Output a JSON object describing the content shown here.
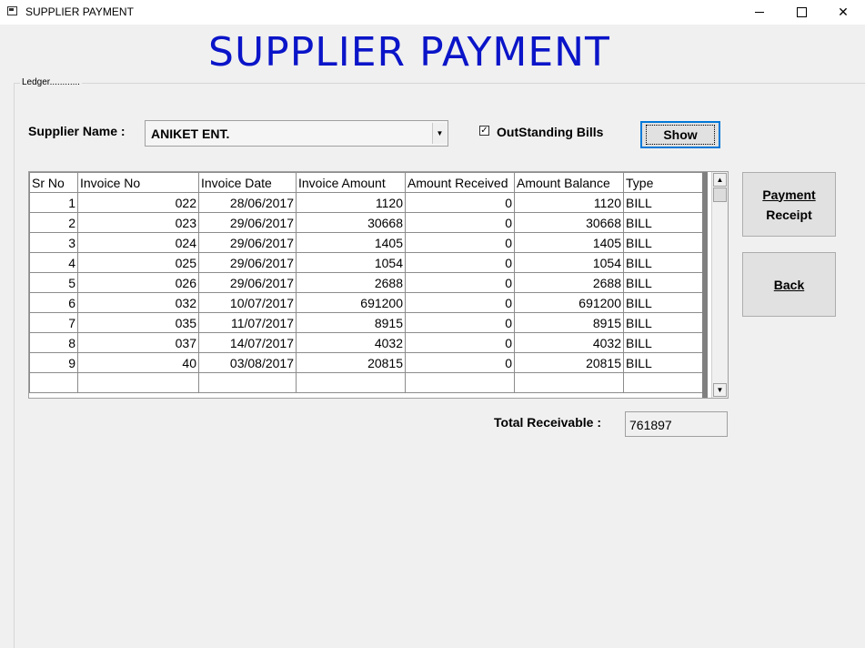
{
  "window": {
    "title": "SUPPLIER PAYMENT",
    "app_icon": "form-icon",
    "controls": [
      "minimize-icon",
      "maximize-icon",
      "close-icon"
    ]
  },
  "header": {
    "title": "SUPPLIER PAYMENT"
  },
  "ledger": {
    "legend": "Ledger............"
  },
  "filters": {
    "supplier_label": "Supplier Name :",
    "supplier_value": "ANIKET ENT.",
    "outstanding_label": "OutStanding Bills",
    "outstanding_checked": true,
    "show_label": "Show"
  },
  "grid": {
    "columns": [
      "Sr No",
      "Invoice No",
      "Invoice Date",
      "Invoice Amount",
      "Amount Received",
      "Amount Balance",
      "Type"
    ],
    "rows": [
      {
        "sr": "1",
        "invoice": "022",
        "date": "28/06/2017",
        "amount": "1120",
        "received": "0",
        "balance": "1120",
        "type": "BILL"
      },
      {
        "sr": "2",
        "invoice": "023",
        "date": "29/06/2017",
        "amount": "30668",
        "received": "0",
        "balance": "30668",
        "type": "BILL"
      },
      {
        "sr": "3",
        "invoice": "024",
        "date": "29/06/2017",
        "amount": "1405",
        "received": "0",
        "balance": "1405",
        "type": "BILL"
      },
      {
        "sr": "4",
        "invoice": "025",
        "date": "29/06/2017",
        "amount": "1054",
        "received": "0",
        "balance": "1054",
        "type": "BILL"
      },
      {
        "sr": "5",
        "invoice": "026",
        "date": "29/06/2017",
        "amount": "2688",
        "received": "0",
        "balance": "2688",
        "type": "BILL"
      },
      {
        "sr": "6",
        "invoice": "032",
        "date": "10/07/2017",
        "amount": "691200",
        "received": "0",
        "balance": "691200",
        "type": "BILL"
      },
      {
        "sr": "7",
        "invoice": "035",
        "date": "11/07/2017",
        "amount": "8915",
        "received": "0",
        "balance": "8915",
        "type": "BILL"
      },
      {
        "sr": "8",
        "invoice": "037",
        "date": "14/07/2017",
        "amount": "4032",
        "received": "0",
        "balance": "4032",
        "type": "BILL"
      },
      {
        "sr": "9",
        "invoice": "40",
        "date": "03/08/2017",
        "amount": "20815",
        "received": "0",
        "balance": "20815",
        "type": "BILL"
      },
      {
        "sr": "",
        "invoice": "",
        "date": "",
        "amount": "",
        "received": "",
        "balance": "",
        "type": ""
      }
    ]
  },
  "actions": {
    "payment_receipt_line1": "Payment",
    "payment_receipt_line2": "Receipt",
    "back_label": "Back"
  },
  "totals": {
    "label": "Total Receivable :",
    "value": "761897"
  }
}
